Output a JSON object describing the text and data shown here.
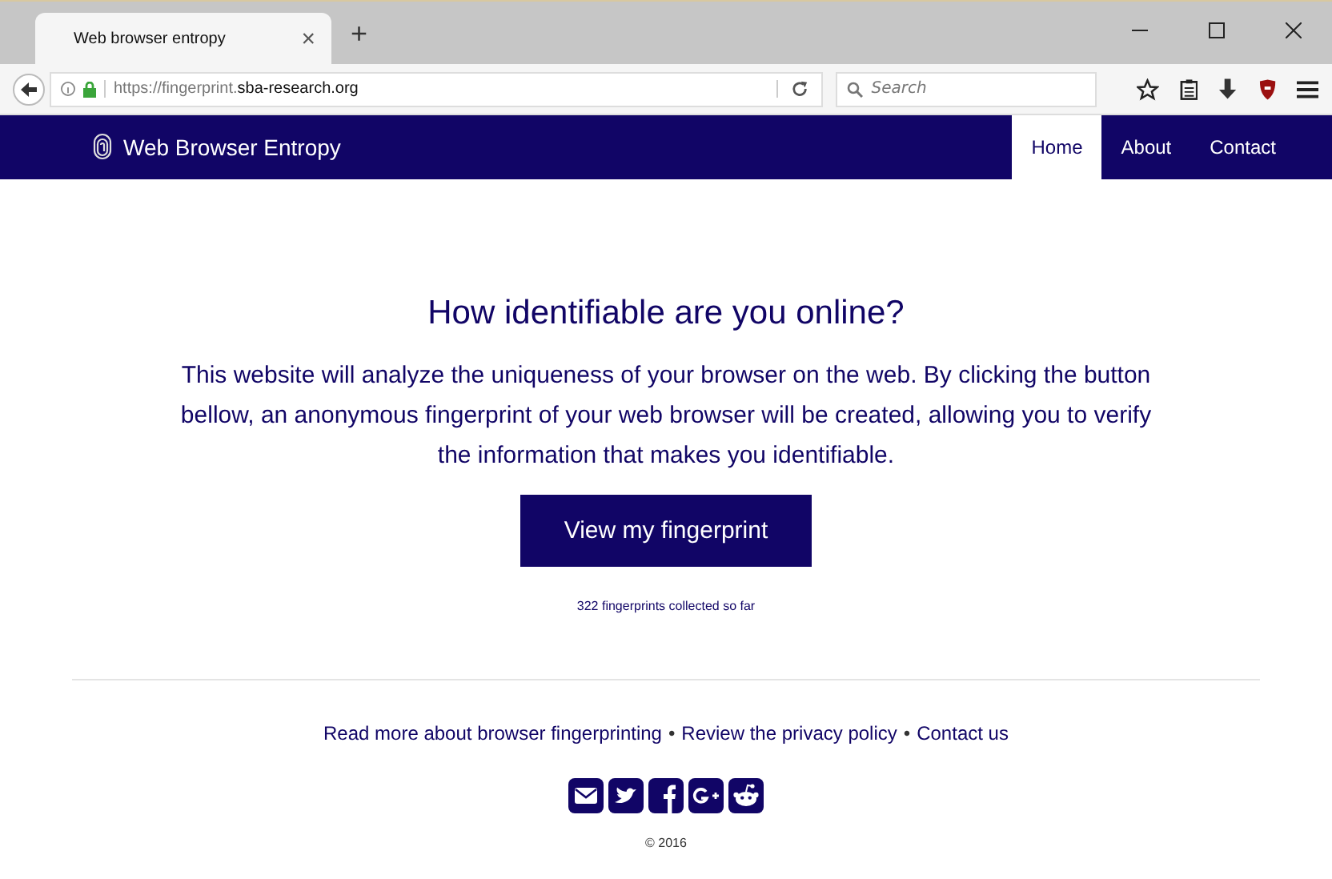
{
  "browser": {
    "tab": {
      "title": "Web browser entropy",
      "close": "×"
    },
    "new_tab": "+",
    "url_prefix": "https://fingerprint.",
    "url_domain": "sba-research.org",
    "search": {
      "placeholder": "Search"
    }
  },
  "navbar": {
    "brand": "Web Browser Entropy",
    "items": [
      {
        "label": "Home",
        "selected": true
      },
      {
        "label": "About",
        "selected": false
      },
      {
        "label": "Contact",
        "selected": false
      }
    ]
  },
  "main": {
    "heading": "How identifiable are you online?",
    "text": "This website will analyze the uniqueness of your browser on the web. By clicking the button bellow, an anonymous fingerprint of your web browser will be created, allowing you to verify the information that makes you identifiable.",
    "button": "View my fingerprint",
    "count": "322 fingerprints collected so far"
  },
  "footer": {
    "items": [
      {
        "kind": "link",
        "text": "Read more about browser fingerprinting"
      },
      {
        "kind": "sep",
        "text": "•"
      },
      {
        "kind": "link",
        "text": "Review the privacy policy"
      },
      {
        "kind": "sep",
        "text": "•"
      },
      {
        "kind": "link",
        "text": "Contact us"
      }
    ],
    "copyright": "© 2016"
  }
}
